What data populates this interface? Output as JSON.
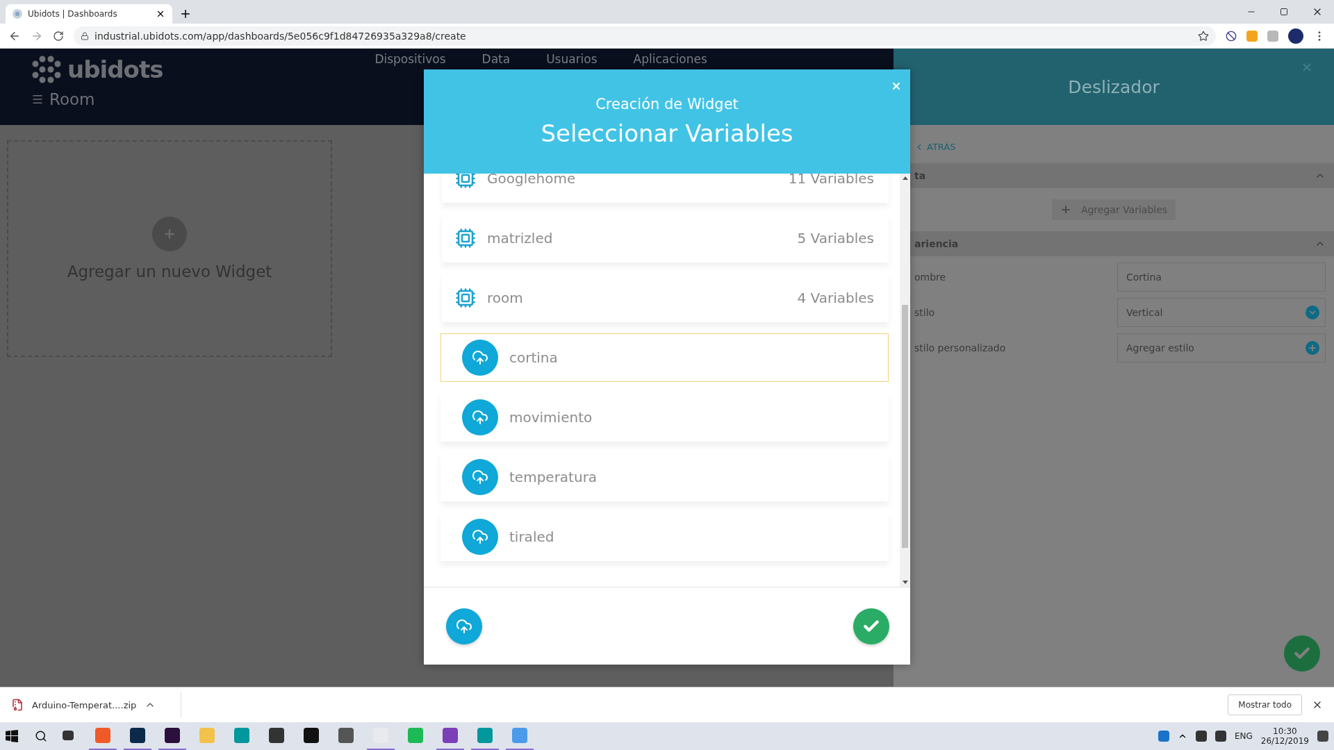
{
  "browser": {
    "tab_title": "Ubidots | Dashboards",
    "url": "industrial.ubidots.com/app/dashboards/5e056c9f1d84726935a329a8/create"
  },
  "app": {
    "logo": "ubidots",
    "nav": [
      {
        "label": "Dispositivos"
      },
      {
        "label": "Data"
      },
      {
        "label": "Usuarios"
      },
      {
        "label": "Aplicaciones"
      }
    ],
    "dashboard": "Room",
    "add_widget": "Agregar un nuevo Widget"
  },
  "side_panel": {
    "title": "Deslizador",
    "back": "ATRÁS",
    "data_section": "ta",
    "add_variables": "Agregar Variables",
    "appearance_section": "ariencia",
    "fields": [
      {
        "label": "ombre",
        "value": "Cortina",
        "kind": "text"
      },
      {
        "label": "stilo",
        "value": "Vertical",
        "kind": "select"
      },
      {
        "label": "stilo personalizado",
        "value": "Agregar estilo",
        "kind": "add"
      }
    ]
  },
  "modal": {
    "subtitle": "Creación de Widget",
    "title": "Seleccionar Variables",
    "items": [
      {
        "kind": "device",
        "name": "Googlehome",
        "count": "11 Variables",
        "selected": false
      },
      {
        "kind": "device",
        "name": "matrizled",
        "count": "5 Variables",
        "selected": false
      },
      {
        "kind": "device",
        "name": "room",
        "count": "4 Variables",
        "selected": false
      },
      {
        "kind": "variable",
        "name": "cortina",
        "selected": true
      },
      {
        "kind": "variable",
        "name": "movimiento",
        "selected": false
      },
      {
        "kind": "variable",
        "name": "temperatura",
        "selected": false
      },
      {
        "kind": "variable",
        "name": "tiraled",
        "selected": false
      }
    ]
  },
  "downloads": {
    "file": "Arduino-Temperat....zip",
    "show_all": "Mostrar todo"
  },
  "taskbar": {
    "lang": "ENG",
    "time": "10:30",
    "date": "26/12/2019"
  }
}
